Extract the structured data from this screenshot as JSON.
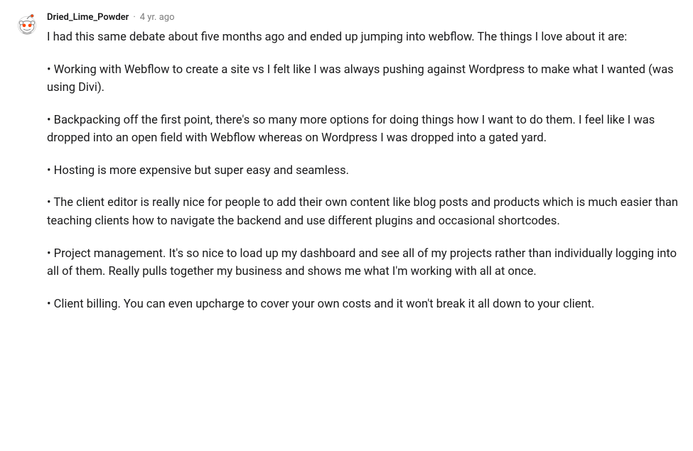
{
  "comment": {
    "username": "Dried_Lime_Powder",
    "separator": "·",
    "timestamp": "4 yr. ago",
    "paragraphs": [
      "I had this same debate about five months ago and ended up jumping into webflow. The things I love about it are:",
      "• Working with Webflow to create a site vs I felt like I was always pushing against Wordpress to make what I wanted (was using Divi).",
      "• Backpacking off the first point, there's so many more options for doing things how I want to do them. I feel like I was dropped into an open field with Webflow whereas on Wordpress I was dropped into a gated yard.",
      "• Hosting is more expensive but super easy and seamless.",
      "• The client editor is really nice for people to add their own content like blog posts and products which is much easier than teaching clients how to navigate the backend and use different plugins and occasional shortcodes.",
      "• Project management. It's so nice to load up my dashboard and see all of my projects rather than individually logging into all of them. Really pulls together my business and shows me what I'm working with all at once.",
      "• Client billing. You can even upcharge to cover your own costs and it won't break it all down to your client."
    ]
  }
}
